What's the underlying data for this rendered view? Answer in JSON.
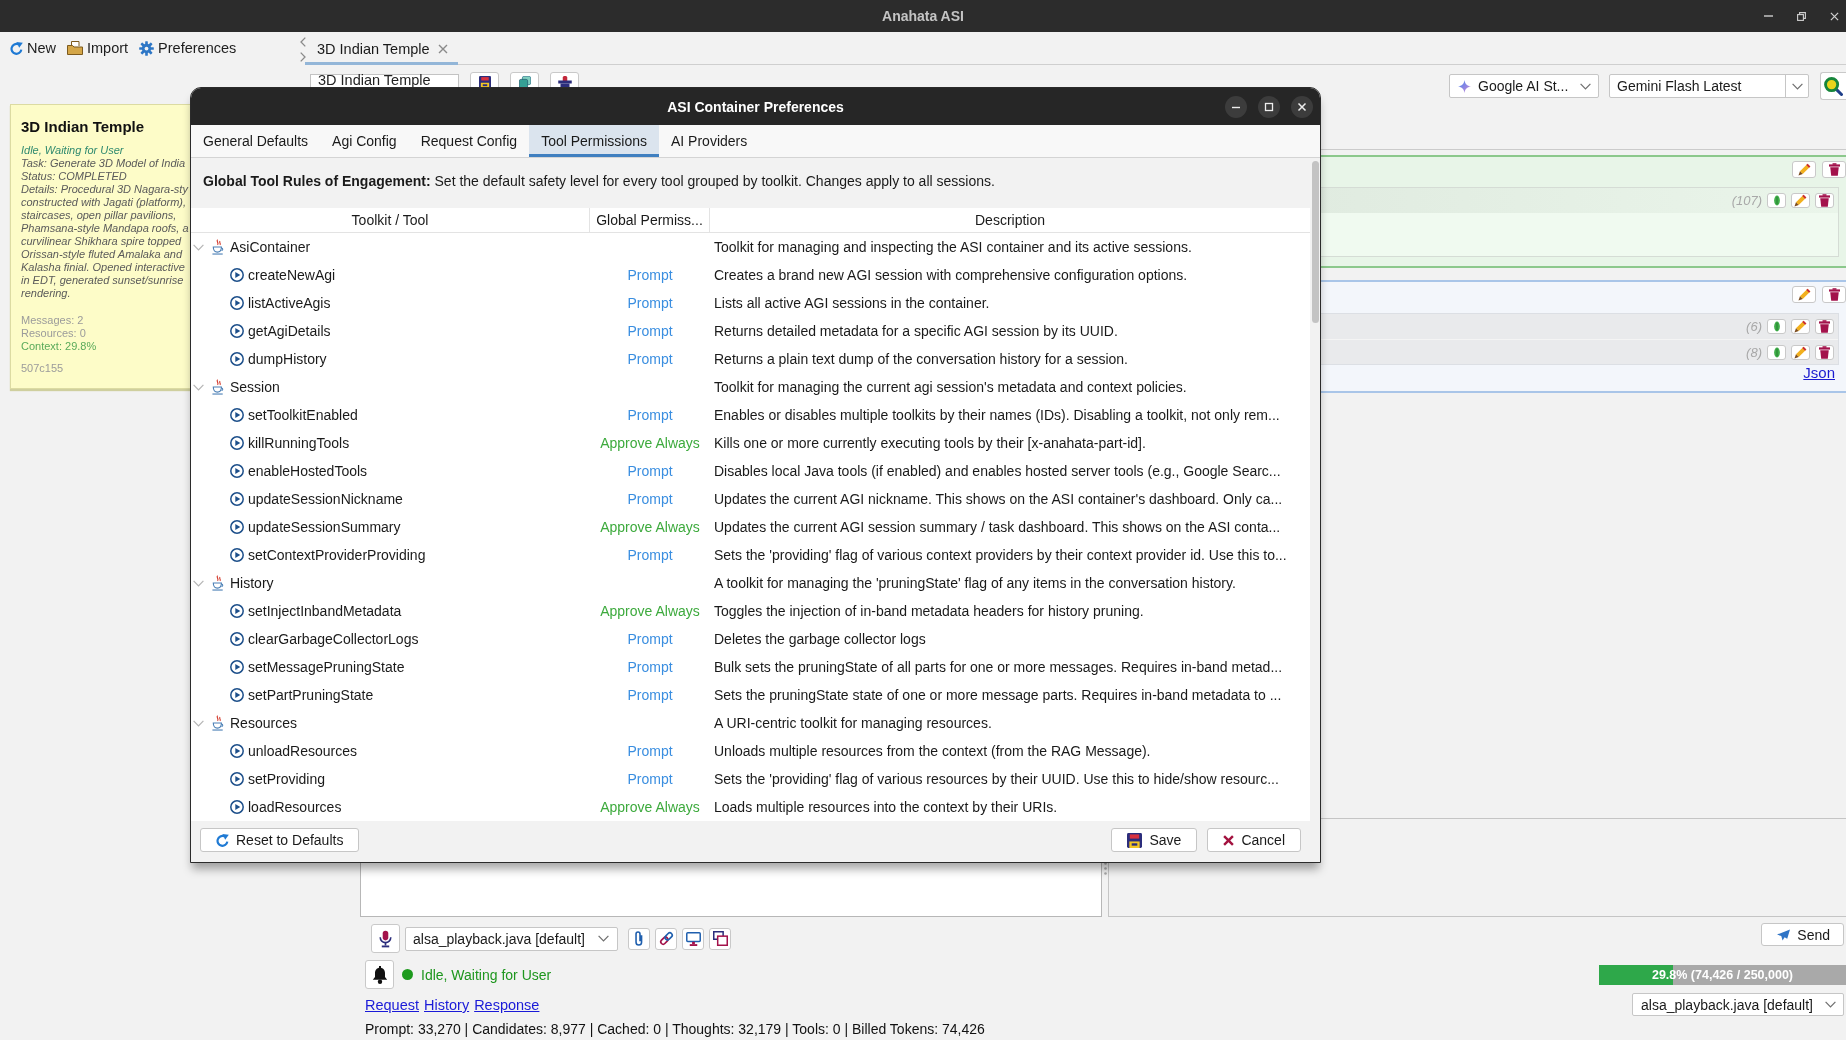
{
  "window": {
    "title": "Anahata ASI"
  },
  "toolbar": [
    {
      "kind": "new",
      "label": "New"
    },
    {
      "kind": "import",
      "label": "Import"
    },
    {
      "kind": "preferences",
      "label": "Preferences"
    }
  ],
  "session_card": {
    "title": "3D Indian Temple",
    "status": "Idle, Waiting for User",
    "details": [
      "Task: Generate 3D Model of India",
      "Status: COMPLETED",
      "Details: Procedural 3D Nagara-sty",
      "constructed with Jagati (platform),",
      "staircases, open pillar pavilions,",
      "Phamsana-style Mandapa roofs, a",
      "curvilinear Shikhara spire topped",
      "Orissan-style fluted Amalaka and",
      "Kalasha finial. Opened interactive",
      "in EDT, generated sunset/sunrise",
      "rendering."
    ],
    "messages": "Messages: 2",
    "resources": "Resources: 0",
    "context": "Context: 29.8%",
    "commit": "507c155"
  },
  "tabs": [
    {
      "label": "3D Indian Temple",
      "selected": true
    }
  ],
  "session_bar": {
    "nickname": "3D Indian Temple",
    "provider": "Google AI St...",
    "model": "Gemini Flash Latest"
  },
  "messages": [
    {
      "kind": "model",
      "parts": [
        {
          "count": "(107)"
        }
      ]
    },
    {
      "kind": "user",
      "parts": [
        {
          "count": "(6)"
        },
        {
          "count": "(8)"
        }
      ],
      "link": "Json"
    }
  ],
  "composer": {
    "context_file": "alsa_playback.java [default]",
    "send": "Send",
    "status": {
      "text": "Idle, Waiting for User",
      "color": "#1e9a1e"
    },
    "links": [
      "Request",
      "History",
      "Response"
    ],
    "context_usage": {
      "level": 0.298,
      "label": "29.8% (74,426 / 250,000)"
    },
    "file_selector": "alsa_playback.java [default]",
    "usage_stats": "Prompt: 33,270 | Candidates: 8,977 | Cached: 0 | Thoughts: 32,179 | Tools: 0 | Billed Tokens: 74,426"
  },
  "dialog": {
    "title": "ASI Container Preferences",
    "tabs": [
      {
        "label": "General Defaults",
        "selected": false
      },
      {
        "label": "Agi Config",
        "selected": false
      },
      {
        "label": "Request Config",
        "selected": false
      },
      {
        "label": "Tool Permissions",
        "selected": true
      },
      {
        "label": "AI Providers",
        "selected": false
      }
    ],
    "intro": "**Global Tool Rules of Engagement:** Set the default safety level for every tool grouped by toolkit. Changes apply to all sessions.",
    "table": {
      "columns": [
        "Toolkit / Tool",
        "Global Permiss...",
        "Description"
      ],
      "rows": [
        {
          "name": "AsiContainer",
          "expanded": true,
          "description": "Toolkit for managing and inspecting the ASI container and its active sessions.",
          "children": [
            {
              "name": "createNewAgi",
              "permission": {
                "text": "Prompt",
                "color": "#3a8ee0"
              },
              "description": "Creates a brand new AGI session with comprehensive configuration options."
            },
            {
              "name": "listActiveAgis",
              "permission": {
                "text": "Prompt",
                "color": "#3a8ee0"
              },
              "description": "Lists all active AGI sessions in the container."
            },
            {
              "name": "getAgiDetails",
              "permission": {
                "text": "Prompt",
                "color": "#3a8ee0"
              },
              "description": "Returns detailed metadata for a specific AGI session by its UUID."
            },
            {
              "name": "dumpHistory",
              "permission": {
                "text": "Prompt",
                "color": "#3a8ee0"
              },
              "description": "Returns a plain text dump of the conversation history for a session."
            }
          ]
        },
        {
          "name": "Session",
          "expanded": true,
          "description": "Toolkit for managing the current agi session's metadata and context policies.",
          "children": [
            {
              "name": "setToolkitEnabled",
              "permission": {
                "text": "Prompt",
                "color": "#3a8ee0"
              },
              "description": "Enables or disables multiple toolkits by their names (IDs). Disabling a toolkit, not only rem..."
            },
            {
              "name": "killRunningTools",
              "permission": {
                "text": "Approve Always",
                "color": "#3daa3d"
              },
              "description": "Kills one or more currently executing tools by their [x-anahata-part-id]."
            },
            {
              "name": "enableHostedTools",
              "permission": {
                "text": "Prompt",
                "color": "#3a8ee0"
              },
              "description": "Disables local Java tools (if enabled) and enables hosted server tools (e.g., Google Searc..."
            },
            {
              "name": "updateSessionNickname",
              "permission": {
                "text": "Prompt",
                "color": "#3a8ee0"
              },
              "description": "Updates the current AGI nickname. This shows on the ASI container's dashboard. Only ca..."
            },
            {
              "name": "updateSessionSummary",
              "permission": {
                "text": "Approve Always",
                "color": "#3daa3d"
              },
              "description": "Updates the current AGI session summary / task dashboard. This shows on the ASI conta..."
            },
            {
              "name": "setContextProviderProviding",
              "permission": {
                "text": "Prompt",
                "color": "#3a8ee0"
              },
              "description": "Sets the 'providing' flag of various context providers by their context provider id. Use this to..."
            }
          ]
        },
        {
          "name": "History",
          "expanded": true,
          "description": "A toolkit for managing the 'pruningState' flag of any items in the conversation history.",
          "children": [
            {
              "name": "setInjectInbandMetadata",
              "permission": {
                "text": "Approve Always",
                "color": "#3daa3d"
              },
              "description": "Toggles the injection of in-band metadata headers for history pruning."
            },
            {
              "name": "clearGarbageCollectorLogs",
              "permission": {
                "text": "Prompt",
                "color": "#3a8ee0"
              },
              "description": "Deletes the garbage collector logs"
            },
            {
              "name": "setMessagePruningState",
              "permission": {
                "text": "Prompt",
                "color": "#3a8ee0"
              },
              "description": "Bulk sets the pruningState of all parts for one or more messages. Requires in-band metad..."
            },
            {
              "name": "setPartPruningState",
              "permission": {
                "text": "Prompt",
                "color": "#3a8ee0"
              },
              "description": "Sets the pruningState state of one or more message parts. Requires in-band metadata to ..."
            }
          ]
        },
        {
          "name": "Resources",
          "expanded": true,
          "description": "A URI-centric toolkit for managing resources.",
          "children": [
            {
              "name": "unloadResources",
              "permission": {
                "text": "Prompt",
                "color": "#3a8ee0"
              },
              "description": "Unloads multiple resources from the context (from the RAG Message)."
            },
            {
              "name": "setProviding",
              "permission": {
                "text": "Prompt",
                "color": "#3a8ee0"
              },
              "description": "Sets the 'providing' flag of various resources by their UUID. Use this to hide/show resourc..."
            },
            {
              "name": "loadResources",
              "permission": {
                "text": "Approve Always",
                "color": "#3daa3d"
              },
              "description": "Loads multiple resources into the context by their URIs."
            }
          ]
        }
      ]
    },
    "buttons": {
      "reset": "Reset to Defaults",
      "save": "Save",
      "cancel": "Cancel"
    }
  }
}
